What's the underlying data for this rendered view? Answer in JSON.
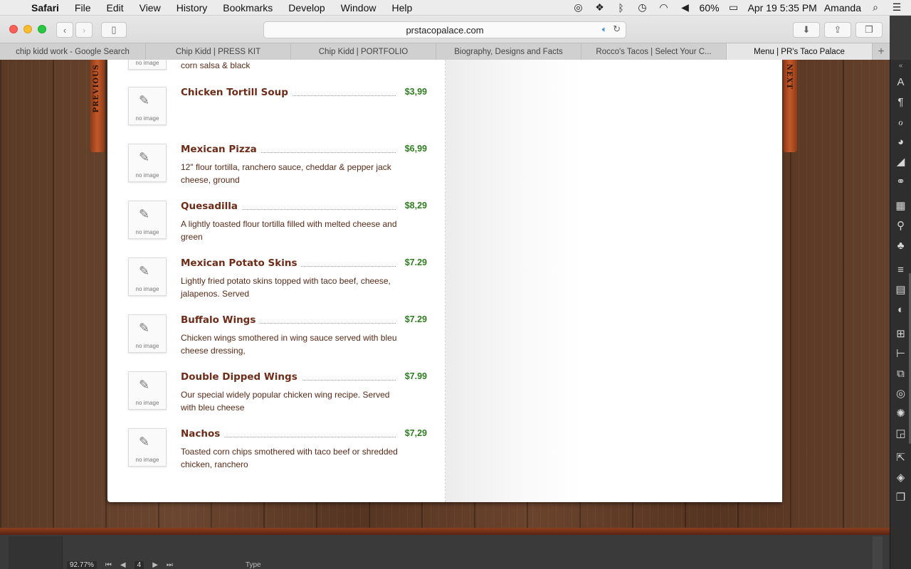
{
  "menubar": {
    "app": "Safari",
    "items": [
      "File",
      "Edit",
      "View",
      "History",
      "Bookmarks",
      "Develop",
      "Window",
      "Help"
    ],
    "battery": "60%",
    "datetime": "Apr 19  5:35 PM",
    "user": "Amanda"
  },
  "browser": {
    "url": "prstacopalace.com",
    "tabs": [
      {
        "label": "chip kidd work - Google Search"
      },
      {
        "label": "Chip Kidd | PRESS KIT"
      },
      {
        "label": "Chip Kidd | PORTFOLIO"
      },
      {
        "label": "Biography, Designs and Facts"
      },
      {
        "label": "Rocco's Tacos | Select Your C..."
      },
      {
        "label": "Menu | PR's Taco Palace"
      }
    ]
  },
  "book": {
    "prev_label": "PREVIOUS",
    "next_label": "NEXT",
    "no_image_label": "no image",
    "partial_item_desc": "corn salsa & black",
    "items": [
      {
        "name": "Chicken Tortill Soup",
        "price": "$3,99",
        "desc": ""
      },
      {
        "name": "Mexican Pizza",
        "price": "$6,99",
        "desc": "12\" flour tortilla, ranchero sauce, cheddar & pepper jack cheese, ground"
      },
      {
        "name": "Quesadilla",
        "price": "$8,29",
        "desc": "A lightly toasted flour tortilla filled with melted cheese and green"
      },
      {
        "name": "Mexican Potato Skins",
        "price": "$7.29",
        "desc": "Lightly fried potato skins topped with taco beef, cheese, jalapenos. Served"
      },
      {
        "name": "Buffalo Wings",
        "price": "$7.29",
        "desc": "Chicken wings smothered in wing sauce served with bleu cheese dressing,"
      },
      {
        "name": "Double Dipped Wings",
        "price": "$7.99",
        "desc": "Our special widely popular chicken wing recipe. Served with bleu cheese"
      },
      {
        "name": "Nachos",
        "price": "$7,29",
        "desc": "Toasted corn chips smothered with taco beef or shredded chicken, ranchero"
      }
    ]
  },
  "app_status": {
    "zoom": "92.77%",
    "page": "4",
    "mode": "Type"
  },
  "colors": {
    "item_name": "#6e2b17",
    "price": "#2e7d1e",
    "wood": "#5a3a25"
  }
}
